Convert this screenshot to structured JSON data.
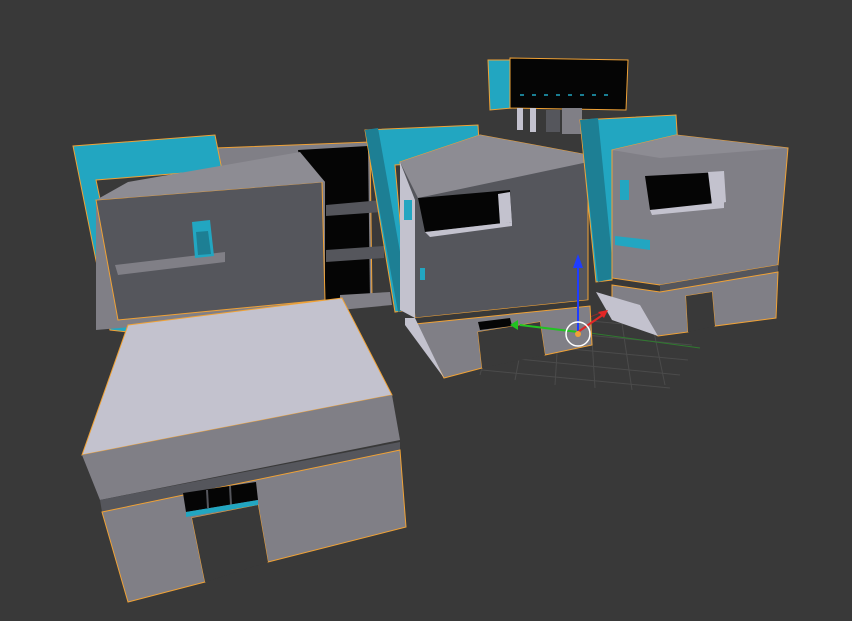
{
  "viewport": {
    "background": "#393939",
    "selection_outline_color": "#f0a236",
    "grid_color": "#4a4a4a",
    "accent_colors": {
      "teal": "#22a6c1",
      "teal_dark": "#1d7f94",
      "wall_dark": "#55565c",
      "wall_mid": "#807f86",
      "wall_light": "#c3c2ce",
      "window_black": "#050505"
    },
    "scene": {
      "object": "building",
      "selected": true
    },
    "gizmo": {
      "axes": [
        {
          "name": "z-axis",
          "color": "#1f3dff"
        },
        {
          "name": "y-axis",
          "color": "#21c321"
        },
        {
          "name": "x-axis",
          "color": "#e32626"
        }
      ],
      "pivot_icon": "3d-cursor-icon"
    }
  }
}
